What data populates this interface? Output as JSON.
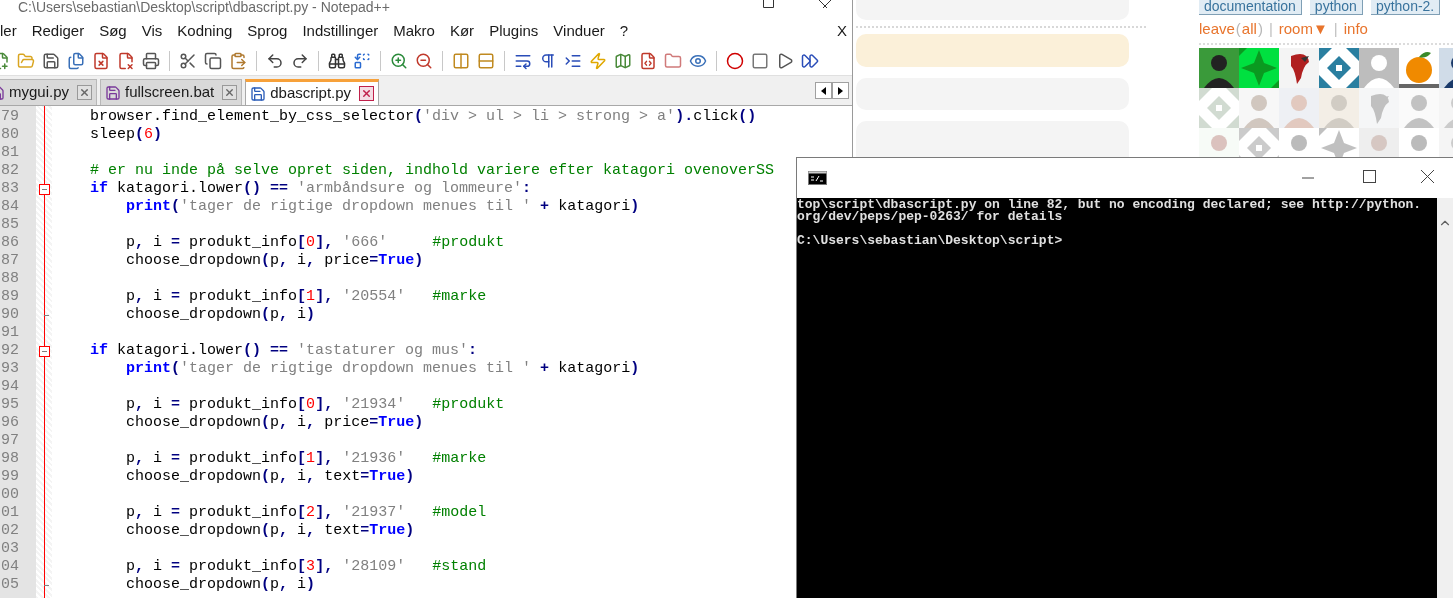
{
  "browser_page": {
    "tags": [
      {
        "label": "documentation"
      },
      {
        "label": "python"
      },
      {
        "label": "python-2."
      }
    ],
    "room_bar": [
      {
        "kind": "link",
        "text": "leave"
      },
      {
        "kind": "punct",
        "text": "("
      },
      {
        "kind": "link",
        "text": "all"
      },
      {
        "kind": "punct",
        "text": ")"
      },
      {
        "kind": "sep",
        "text": "|"
      },
      {
        "kind": "link",
        "text": "room▼"
      },
      {
        "kind": "sep",
        "text": "|"
      },
      {
        "kind": "link",
        "text": "info"
      }
    ],
    "messages": [
      {
        "highlighted": false
      },
      {
        "highlighted": true
      },
      {
        "highlighted": false
      },
      {
        "highlighted": false
      }
    ],
    "avatars": [
      {
        "kind": "picture",
        "active": true
      },
      {
        "kind": "picture",
        "active": true
      },
      {
        "kind": "picture",
        "active": true
      },
      {
        "kind": "picture",
        "active": true
      },
      {
        "kind": "picture",
        "active": true
      },
      {
        "kind": "picture",
        "active": true
      },
      {
        "kind": "picture",
        "active": true
      },
      {
        "kind": "picture",
        "active": false
      },
      {
        "kind": "picture",
        "active": false
      },
      {
        "kind": "picture",
        "active": false
      },
      {
        "kind": "picture",
        "active": false
      },
      {
        "kind": "picture",
        "active": false
      },
      {
        "kind": "picture",
        "active": false
      },
      {
        "kind": "picture",
        "active": false
      },
      {
        "kind": "picture",
        "active": false
      },
      {
        "kind": "picture",
        "active": false
      },
      {
        "kind": "picture",
        "active": false
      },
      {
        "kind": "picture",
        "active": false
      },
      {
        "kind": "picture",
        "active": false
      },
      {
        "kind": "picture",
        "active": false
      },
      {
        "kind": "picture",
        "active": false
      }
    ]
  },
  "editor": {
    "title": "C:\\Users\\sebastian\\Desktop\\script\\dbascript.py - Notepad++",
    "menu": [
      "ler",
      "Rediger",
      "Søg",
      "Vis",
      "Kodning",
      "Sprog",
      "Indstillinger",
      "Makro",
      "Kør",
      "Plugins",
      "Vinduer",
      "?"
    ],
    "menu_close": "X",
    "tabs": [
      {
        "label": "mygui.py",
        "selected": false
      },
      {
        "label": "fullscreen.bat",
        "selected": false
      },
      {
        "label": "dbascript.py",
        "selected": true
      }
    ],
    "lines": [
      {
        "no": "79",
        "tokens": [
          {
            "kind": "plain",
            "text": "    browser.find_element_by_css_selector"
          },
          {
            "kind": "op",
            "text": "("
          },
          {
            "kind": "string",
            "text": "'div > ul > li > strong > a'"
          },
          {
            "kind": "op",
            "text": ")."
          },
          {
            "kind": "plain",
            "text": "click"
          },
          {
            "kind": "op",
            "text": "()"
          }
        ]
      },
      {
        "no": "80",
        "tokens": [
          {
            "kind": "plain",
            "text": "    sleep"
          },
          {
            "kind": "op",
            "text": "("
          },
          {
            "kind": "number",
            "text": "6"
          },
          {
            "kind": "op",
            "text": ")"
          }
        ]
      },
      {
        "no": "81"
      },
      {
        "no": "82",
        "tokens": [
          {
            "kind": "comment",
            "text": "    # er nu inde på selve opret siden, indhold variere efter katagori ovenoverSS"
          }
        ]
      },
      {
        "no": "83",
        "kind": "header",
        "tokens": [
          {
            "kind": "keyword",
            "text": "    if"
          },
          {
            "kind": "plain",
            "text": " katagori.lower"
          },
          {
            "kind": "op",
            "text": "() == "
          },
          {
            "kind": "string",
            "text": "'armbåndsure og lommeure'"
          },
          {
            "kind": "op",
            "text": ":"
          }
        ]
      },
      {
        "no": "84",
        "tokens": [
          {
            "kind": "keyword",
            "text": "        print"
          },
          {
            "kind": "op",
            "text": "("
          },
          {
            "kind": "string",
            "text": "'tager de rigtige dropdown menues til '"
          },
          {
            "kind": "op",
            "text": " + "
          },
          {
            "kind": "plain",
            "text": "katagori"
          },
          {
            "kind": "op",
            "text": ")"
          }
        ]
      },
      {
        "no": "85"
      },
      {
        "no": "86",
        "tokens": [
          {
            "kind": "plain",
            "text": "        p"
          },
          {
            "kind": "op",
            "text": ","
          },
          {
            "kind": "plain",
            "text": " i "
          },
          {
            "kind": "op",
            "text": "="
          },
          {
            "kind": "plain",
            "text": " produkt_info"
          },
          {
            "kind": "op",
            "text": "["
          },
          {
            "kind": "number",
            "text": "0"
          },
          {
            "kind": "op",
            "text": "], "
          },
          {
            "kind": "string",
            "text": "'666'"
          },
          {
            "kind": "comment",
            "text": "     #produkt"
          }
        ]
      },
      {
        "no": "87",
        "tokens": [
          {
            "kind": "plain",
            "text": "        choose_dropdown"
          },
          {
            "kind": "op",
            "text": "("
          },
          {
            "kind": "plain",
            "text": "p"
          },
          {
            "kind": "op",
            "text": ","
          },
          {
            "kind": "plain",
            "text": " i"
          },
          {
            "kind": "op",
            "text": ","
          },
          {
            "kind": "plain",
            "text": " price"
          },
          {
            "kind": "op",
            "text": "="
          },
          {
            "kind": "keyword",
            "text": "True"
          },
          {
            "kind": "op",
            "text": ")"
          }
        ]
      },
      {
        "no": "88"
      },
      {
        "no": "89",
        "tokens": [
          {
            "kind": "plain",
            "text": "        p"
          },
          {
            "kind": "op",
            "text": ","
          },
          {
            "kind": "plain",
            "text": " i "
          },
          {
            "kind": "op",
            "text": "="
          },
          {
            "kind": "plain",
            "text": " produkt_info"
          },
          {
            "kind": "op",
            "text": "["
          },
          {
            "kind": "number",
            "text": "1"
          },
          {
            "kind": "op",
            "text": "], "
          },
          {
            "kind": "string",
            "text": "'20554'"
          },
          {
            "kind": "comment",
            "text": "   #marke"
          }
        ]
      },
      {
        "no": "90",
        "kind": "end",
        "tokens": [
          {
            "kind": "plain",
            "text": "        choose_dropdown"
          },
          {
            "kind": "op",
            "text": "("
          },
          {
            "kind": "plain",
            "text": "p"
          },
          {
            "kind": "op",
            "text": ","
          },
          {
            "kind": "plain",
            "text": " i"
          },
          {
            "kind": "op",
            "text": ")"
          }
        ]
      },
      {
        "no": "91"
      },
      {
        "no": "92",
        "kind": "header",
        "tokens": [
          {
            "kind": "keyword",
            "text": "    if"
          },
          {
            "kind": "plain",
            "text": " katagori.lower"
          },
          {
            "kind": "op",
            "text": "() == "
          },
          {
            "kind": "string",
            "text": "'tastaturer og mus'"
          },
          {
            "kind": "op",
            "text": ":"
          }
        ]
      },
      {
        "no": "93",
        "tokens": [
          {
            "kind": "keyword",
            "text": "        print"
          },
          {
            "kind": "op",
            "text": "("
          },
          {
            "kind": "string",
            "text": "'tager de rigtige dropdown menues til '"
          },
          {
            "kind": "op",
            "text": " + "
          },
          {
            "kind": "plain",
            "text": "katagori"
          },
          {
            "kind": "op",
            "text": ")"
          }
        ]
      },
      {
        "no": "94"
      },
      {
        "no": "95",
        "tokens": [
          {
            "kind": "plain",
            "text": "        p"
          },
          {
            "kind": "op",
            "text": ","
          },
          {
            "kind": "plain",
            "text": " i "
          },
          {
            "kind": "op",
            "text": "="
          },
          {
            "kind": "plain",
            "text": " produkt_info"
          },
          {
            "kind": "op",
            "text": "["
          },
          {
            "kind": "number",
            "text": "0"
          },
          {
            "kind": "op",
            "text": "], "
          },
          {
            "kind": "string",
            "text": "'21934'"
          },
          {
            "kind": "comment",
            "text": "   #produkt"
          }
        ]
      },
      {
        "no": "96",
        "tokens": [
          {
            "kind": "plain",
            "text": "        choose_dropdown"
          },
          {
            "kind": "op",
            "text": "("
          },
          {
            "kind": "plain",
            "text": "p"
          },
          {
            "kind": "op",
            "text": ","
          },
          {
            "kind": "plain",
            "text": " i"
          },
          {
            "kind": "op",
            "text": ","
          },
          {
            "kind": "plain",
            "text": " price"
          },
          {
            "kind": "op",
            "text": "="
          },
          {
            "kind": "keyword",
            "text": "True"
          },
          {
            "kind": "op",
            "text": ")"
          }
        ]
      },
      {
        "no": "97"
      },
      {
        "no": "98",
        "tokens": [
          {
            "kind": "plain",
            "text": "        p"
          },
          {
            "kind": "op",
            "text": ","
          },
          {
            "kind": "plain",
            "text": " i "
          },
          {
            "kind": "op",
            "text": "="
          },
          {
            "kind": "plain",
            "text": " produkt_info"
          },
          {
            "kind": "op",
            "text": "["
          },
          {
            "kind": "number",
            "text": "1"
          },
          {
            "kind": "op",
            "text": "], "
          },
          {
            "kind": "string",
            "text": "'21936'"
          },
          {
            "kind": "comment",
            "text": "   #marke"
          }
        ]
      },
      {
        "no": "99",
        "tokens": [
          {
            "kind": "plain",
            "text": "        choose_dropdown"
          },
          {
            "kind": "op",
            "text": "("
          },
          {
            "kind": "plain",
            "text": "p"
          },
          {
            "kind": "op",
            "text": ","
          },
          {
            "kind": "plain",
            "text": " i"
          },
          {
            "kind": "op",
            "text": ","
          },
          {
            "kind": "plain",
            "text": " text"
          },
          {
            "kind": "op",
            "text": "="
          },
          {
            "kind": "keyword",
            "text": "True"
          },
          {
            "kind": "op",
            "text": ")"
          }
        ]
      },
      {
        "no": "00"
      },
      {
        "no": "01",
        "tokens": [
          {
            "kind": "plain",
            "text": "        p"
          },
          {
            "kind": "op",
            "text": ","
          },
          {
            "kind": "plain",
            "text": " i "
          },
          {
            "kind": "op",
            "text": "="
          },
          {
            "kind": "plain",
            "text": " produkt_info"
          },
          {
            "kind": "op",
            "text": "["
          },
          {
            "kind": "number",
            "text": "2"
          },
          {
            "kind": "op",
            "text": "], "
          },
          {
            "kind": "string",
            "text": "'21937'"
          },
          {
            "kind": "comment",
            "text": "   #model"
          }
        ]
      },
      {
        "no": "02",
        "tokens": [
          {
            "kind": "plain",
            "text": "        choose_dropdown"
          },
          {
            "kind": "op",
            "text": "("
          },
          {
            "kind": "plain",
            "text": "p"
          },
          {
            "kind": "op",
            "text": ","
          },
          {
            "kind": "plain",
            "text": " i"
          },
          {
            "kind": "op",
            "text": ","
          },
          {
            "kind": "plain",
            "text": " text"
          },
          {
            "kind": "op",
            "text": "="
          },
          {
            "kind": "keyword",
            "text": "True"
          },
          {
            "kind": "op",
            "text": ")"
          }
        ]
      },
      {
        "no": "03"
      },
      {
        "no": "04",
        "tokens": [
          {
            "kind": "plain",
            "text": "        p"
          },
          {
            "kind": "op",
            "text": ","
          },
          {
            "kind": "plain",
            "text": " i "
          },
          {
            "kind": "op",
            "text": "="
          },
          {
            "kind": "plain",
            "text": " produkt_info"
          },
          {
            "kind": "op",
            "text": "["
          },
          {
            "kind": "number",
            "text": "3"
          },
          {
            "kind": "op",
            "text": "], "
          },
          {
            "kind": "string",
            "text": "'28109'"
          },
          {
            "kind": "comment",
            "text": "   #stand"
          }
        ]
      },
      {
        "no": "05",
        "kind": "end",
        "tokens": [
          {
            "kind": "plain",
            "text": "        choose_dropdown"
          },
          {
            "kind": "op",
            "text": "("
          },
          {
            "kind": "plain",
            "text": "p"
          },
          {
            "kind": "op",
            "text": ","
          },
          {
            "kind": "plain",
            "text": " i"
          },
          {
            "kind": "op",
            "text": ")"
          }
        ]
      }
    ]
  },
  "console": {
    "output": [
      "top\\script\\dbascript.py on line 82, but no encoding declared; see http://python.",
      "org/dev/peps/pep-0263/ for details"
    ],
    "prompt": "C:\\Users\\sebastian\\Desktop\\script>"
  }
}
